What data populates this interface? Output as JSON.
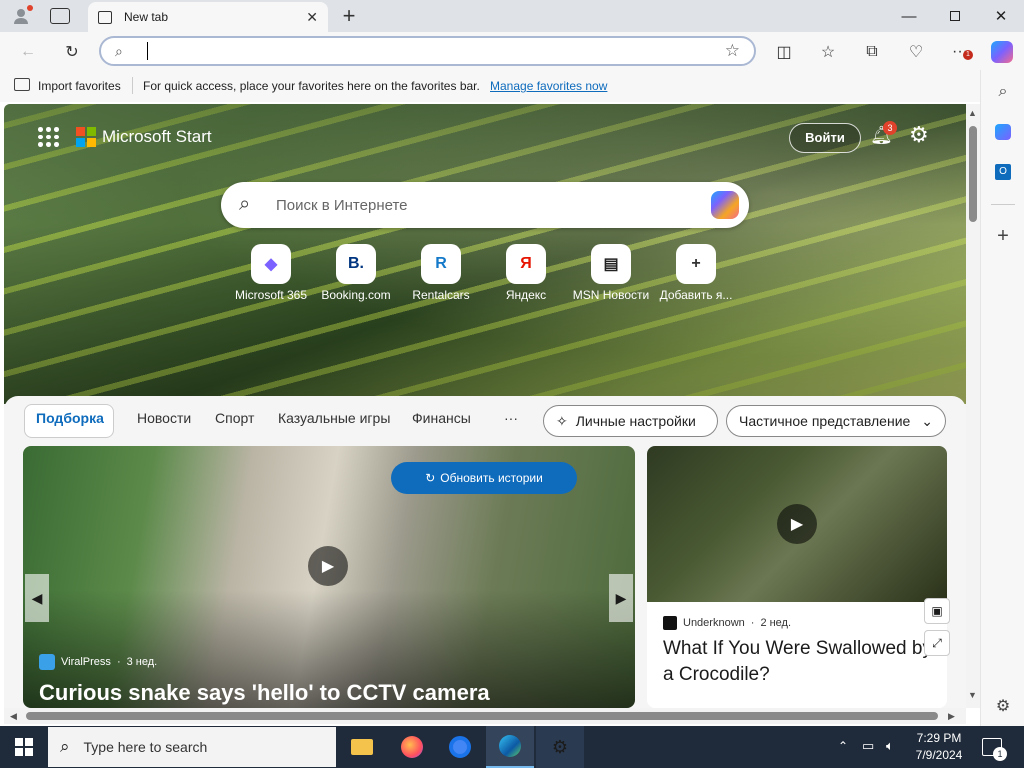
{
  "browser": {
    "tab_title": "New tab",
    "favorites_bar": {
      "import_label": "Import favorites",
      "hint_text": "For quick access, place your favorites here on the favorites bar.",
      "manage_link": "Manage favorites now"
    },
    "address": {
      "value": "",
      "placeholder": ""
    }
  },
  "page": {
    "brand": "Microsoft Start",
    "login_button": "Войти",
    "notification_count": "3",
    "search_placeholder": "Поиск в Интернете",
    "quick_links": [
      {
        "label": "Microsoft 365",
        "glyph": "◆",
        "color": "#7b61ff"
      },
      {
        "label": "Booking.com",
        "glyph": "B.",
        "color": "#003580"
      },
      {
        "label": "Rentalcars",
        "glyph": "R",
        "color": "#1479c9"
      },
      {
        "label": "Яндекс",
        "glyph": "Я",
        "color": "#e61400"
      },
      {
        "label": "MSN Новости",
        "glyph": "▤",
        "color": "#222222"
      },
      {
        "label": "Добавить я...",
        "glyph": "+",
        "color": "#333333"
      }
    ],
    "nav_tabs": [
      "Подборка",
      "Новости",
      "Спорт",
      "Казуальные игры",
      "Финансы",
      "···"
    ],
    "personal_settings": "Личные настройки",
    "partial_view": "Частичное представление",
    "refresh_stories": "Обновить истории",
    "cards": {
      "main": {
        "source": "ViralPress",
        "age": "3 нед.",
        "title": "Curious snake says 'hello' to CCTV camera"
      },
      "side": {
        "source": "Underknown",
        "age": "2 нед.",
        "title": "What If You Were Swallowed by a Crocodile?"
      }
    }
  },
  "taskbar": {
    "search_placeholder": "Type here to search",
    "time": "7:29 PM",
    "date": "7/9/2024",
    "notification_count": "1"
  },
  "colors": {
    "accent": "#0f6cbd",
    "notification_badge": "#e0422c",
    "taskbar": "#1f2b3a"
  }
}
